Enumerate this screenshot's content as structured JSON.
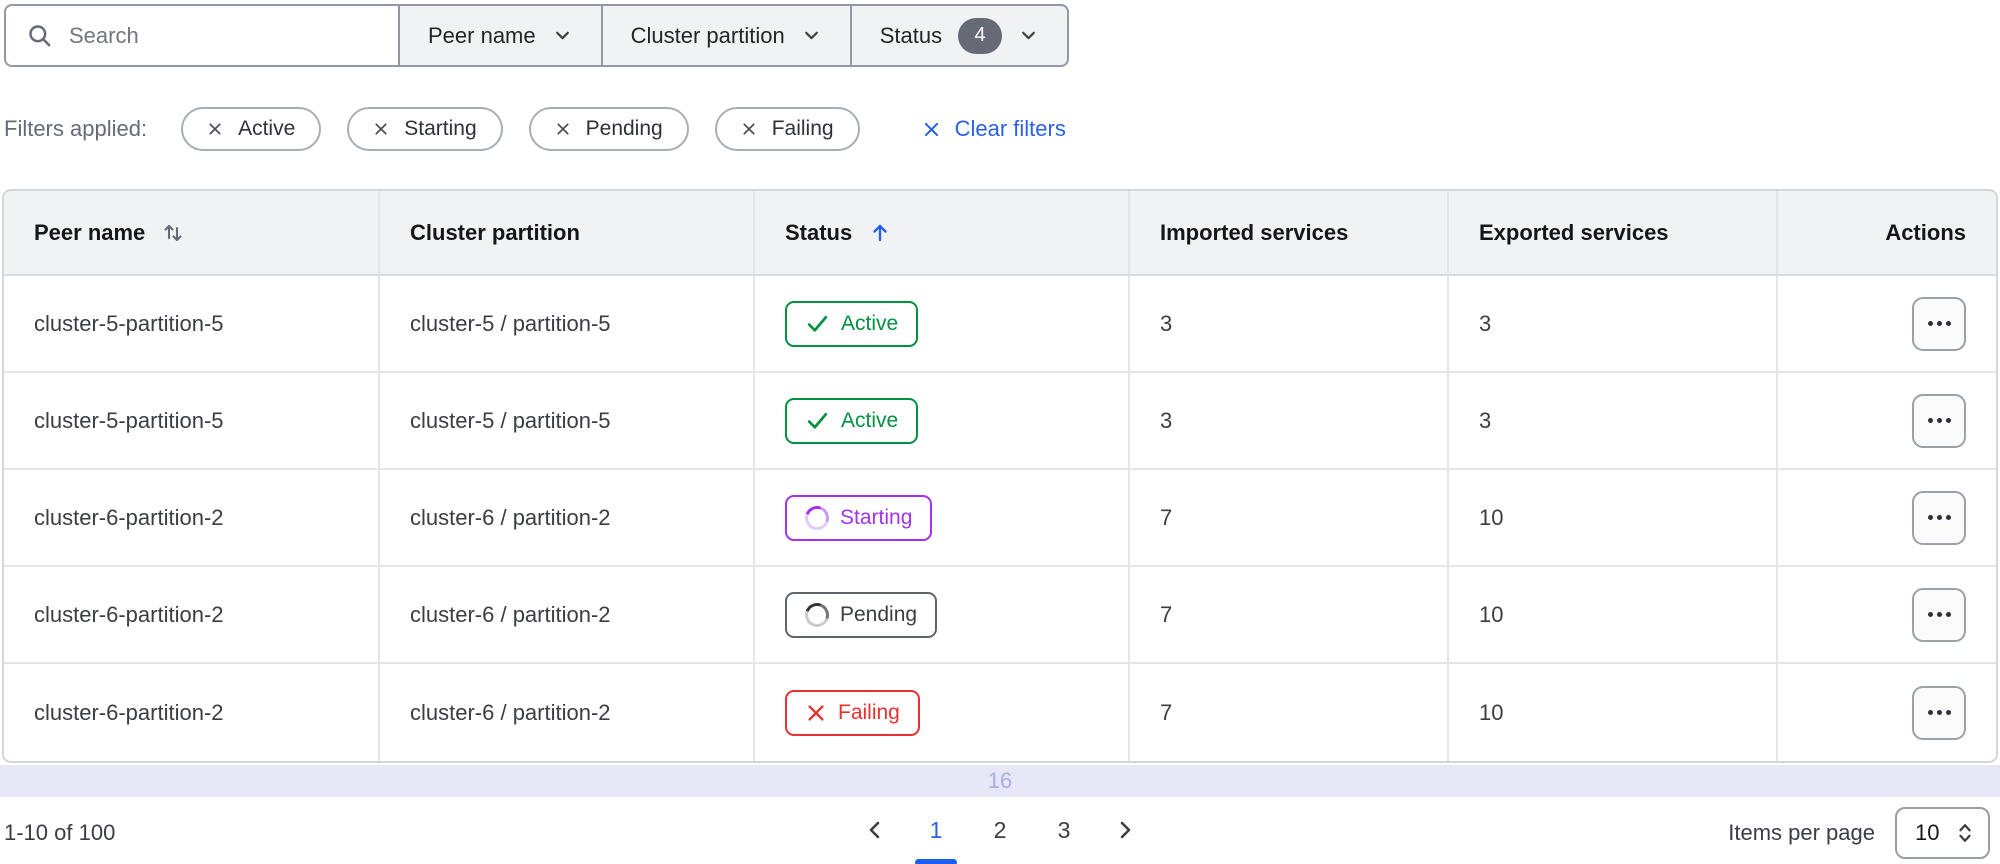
{
  "toolbar": {
    "search": {
      "placeholder": "Search"
    },
    "dropdowns": [
      {
        "label": "Peer name"
      },
      {
        "label": "Cluster partition"
      },
      {
        "label": "Status",
        "badge": "4"
      }
    ]
  },
  "filters": {
    "label": "Filters applied:",
    "tags": [
      "Active",
      "Starting",
      "Pending",
      "Failing"
    ],
    "clear_label": "Clear filters"
  },
  "table": {
    "columns": [
      {
        "label": "Peer name",
        "sort": "sortable"
      },
      {
        "label": "Cluster partition",
        "sort": "none"
      },
      {
        "label": "Status",
        "sort": "ascending"
      },
      {
        "label": "Imported services",
        "sort": "none"
      },
      {
        "label": "Exported services",
        "sort": "none"
      },
      {
        "label": "Actions",
        "sort": "none"
      }
    ],
    "rows": [
      {
        "peer_name": "cluster-5-partition-5",
        "cluster_partition": "cluster-5 / partition-5",
        "status": "Active",
        "status_type": "active",
        "imported": "3",
        "exported": "3"
      },
      {
        "peer_name": "cluster-5-partition-5",
        "cluster_partition": "cluster-5 / partition-5",
        "status": "Active",
        "status_type": "active",
        "imported": "3",
        "exported": "3"
      },
      {
        "peer_name": "cluster-6-partition-2",
        "cluster_partition": "cluster-6 / partition-2",
        "status": "Starting",
        "status_type": "starting",
        "imported": "7",
        "exported": "10"
      },
      {
        "peer_name": "cluster-6-partition-2",
        "cluster_partition": "cluster-6 / partition-2",
        "status": "Pending",
        "status_type": "pending",
        "imported": "7",
        "exported": "10"
      },
      {
        "peer_name": "cluster-6-partition-2",
        "cluster_partition": "cluster-6 / partition-2",
        "status": "Failing",
        "status_type": "failing",
        "imported": "7",
        "exported": "10"
      }
    ],
    "overflow_indicator": "16"
  },
  "pagination": {
    "range_label": "1-10 of 100",
    "pages": [
      "1",
      "2",
      "3"
    ],
    "current_page": "1",
    "items_per_page_label": "Items per page",
    "page_size": "10"
  },
  "colors": {
    "accent_blue": "#2962e9",
    "status_active_green": "#009240",
    "status_starting_purple": "#a232f0",
    "status_pending_gray": "#60646c",
    "status_failing_red": "#e8312f",
    "badge_count_bg": "#656a76",
    "header_bg": "#f1f2f3",
    "overflow_strip_bg": "#e8e7f8"
  }
}
